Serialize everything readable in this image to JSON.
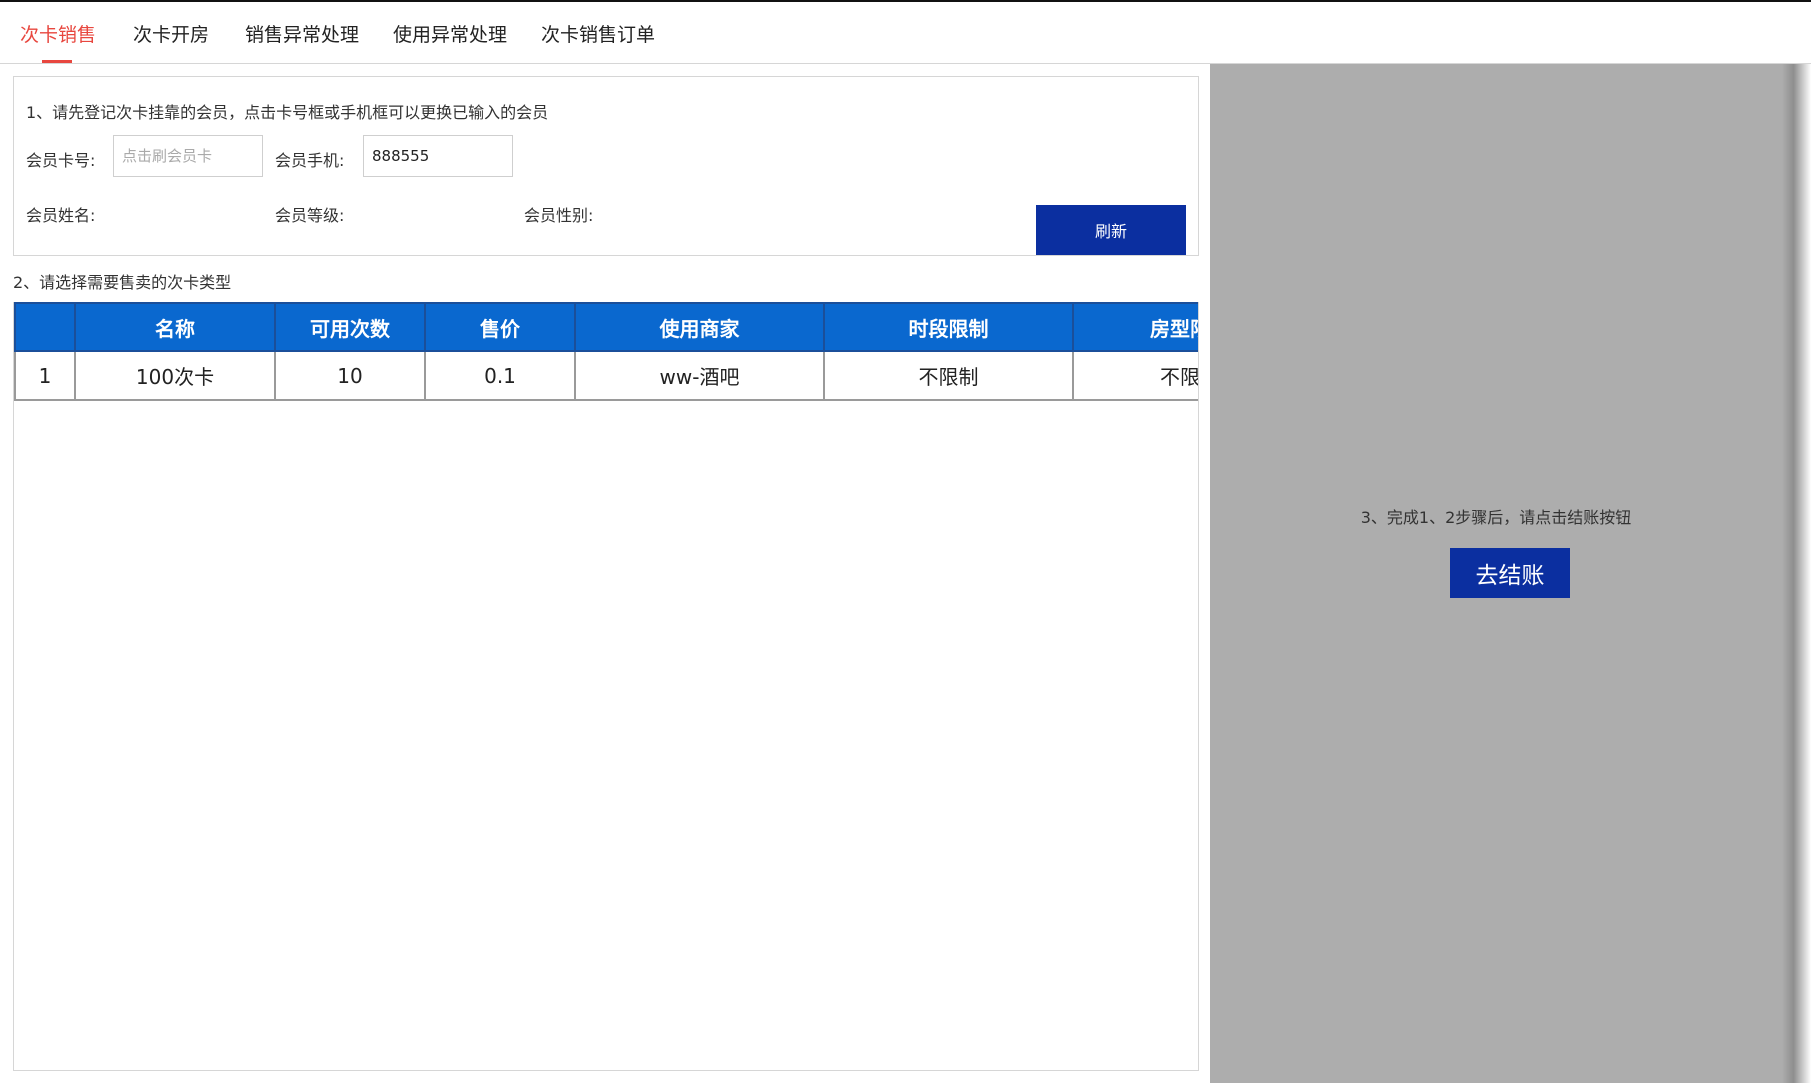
{
  "tabs": [
    {
      "label": "次卡销售",
      "active": true
    },
    {
      "label": "次卡开房",
      "active": false
    },
    {
      "label": "销售异常处理",
      "active": false
    },
    {
      "label": "使用异常处理",
      "active": false
    },
    {
      "label": "次卡销售订单",
      "active": false
    }
  ],
  "member": {
    "step_text": "1、请先登记次卡挂靠的会员，点击卡号框或手机框可以更换已输入的会员",
    "card_label": "会员卡号:",
    "card_placeholder": "点击刷会员卡",
    "card_value": "",
    "phone_label": "会员手机:",
    "phone_value": "888555",
    "name_label": "会员姓名:",
    "level_label": "会员等级:",
    "gender_label": "会员性别:",
    "refresh_label": "刷新"
  },
  "card_types": {
    "step_text": "2、请选择需要售卖的次卡类型",
    "columns": [
      "",
      "名称",
      "可用次数",
      "售价",
      "使用商家",
      "时段限制",
      "房型限制"
    ],
    "rows": [
      [
        "1",
        "100次卡",
        "10",
        "0.1",
        "ww-酒吧",
        "不限制",
        "不限制"
      ]
    ]
  },
  "checkout": {
    "step_text": "3、完成1、2步骤后，请点击结账按钮",
    "button_label": "去结账"
  },
  "colors": {
    "active_tab": "#e8473f",
    "primary_button": "#0b2fa0",
    "table_header": "#0a68cf",
    "right_panel": "#adadad"
  }
}
